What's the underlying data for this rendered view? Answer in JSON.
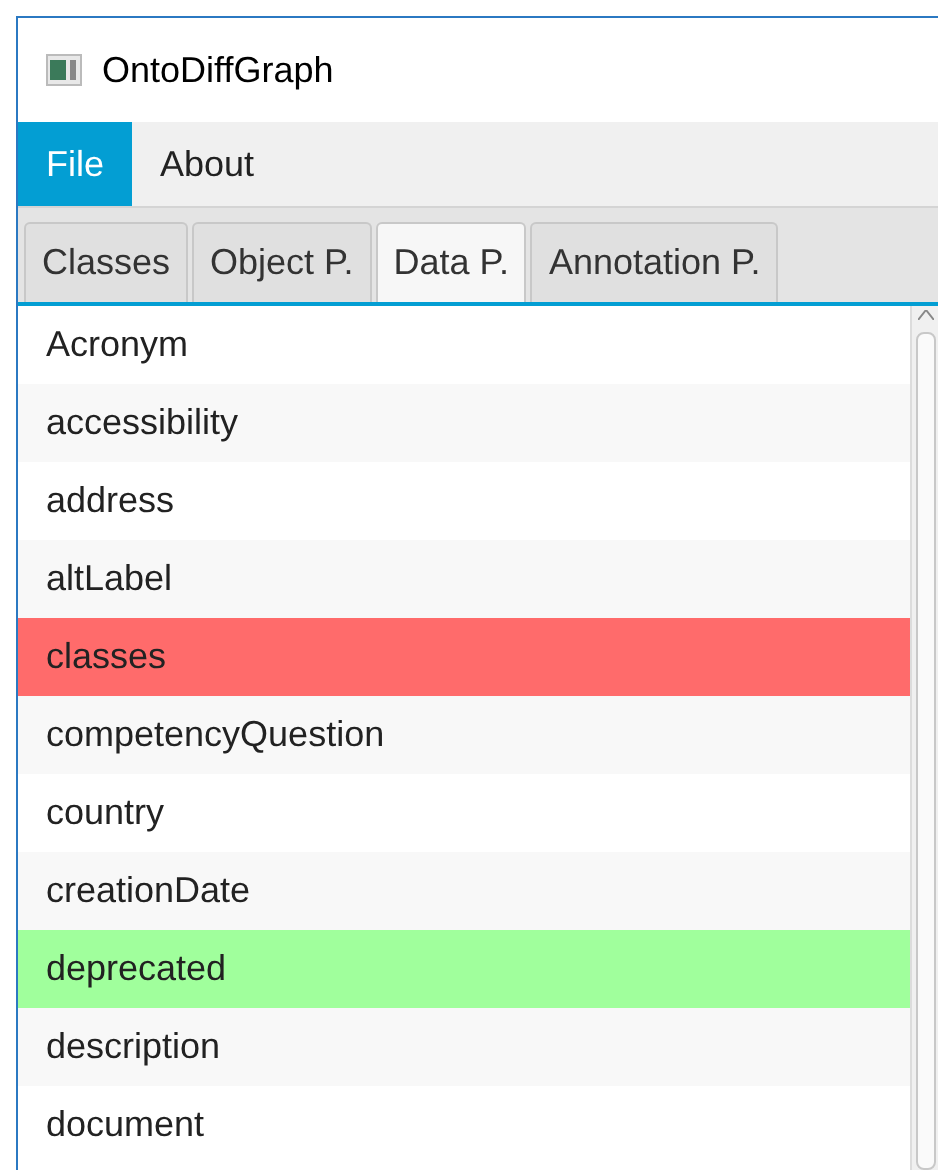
{
  "window": {
    "title": "OntoDiffGraph"
  },
  "menu": [
    {
      "label": "File",
      "selected": true
    },
    {
      "label": "About",
      "selected": false
    }
  ],
  "tabs": [
    {
      "label": "Classes",
      "selected": false
    },
    {
      "label": "Object P.",
      "selected": false
    },
    {
      "label": "Data P.",
      "selected": true
    },
    {
      "label": "Annotation P.",
      "selected": false
    }
  ],
  "list": [
    {
      "label": "Acronym"
    },
    {
      "label": "accessibility"
    },
    {
      "label": "address"
    },
    {
      "label": "altLabel"
    },
    {
      "label": "classes",
      "color": "#ff6b6b"
    },
    {
      "label": "competencyQuestion"
    },
    {
      "label": "country"
    },
    {
      "label": "creationDate"
    },
    {
      "label": "deprecated",
      "color": "#a0ff9c"
    },
    {
      "label": "description"
    },
    {
      "label": "document"
    }
  ]
}
